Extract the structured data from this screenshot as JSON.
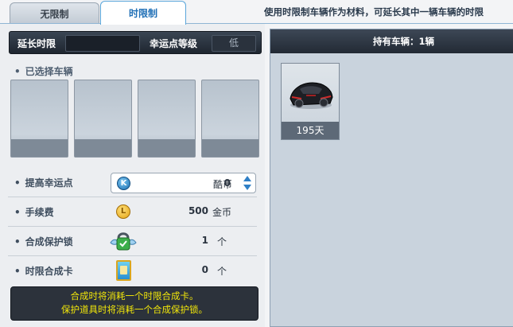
{
  "tabs": [
    {
      "label": "无限制",
      "active": false
    },
    {
      "label": "时限制",
      "active": true
    }
  ],
  "hint_text": "使用时限制车辆作为材料，可延长其中一辆车辆的时限",
  "extend_bar": {
    "extend_label": "延长时限",
    "extend_value": "",
    "luck_level_label": "幸运点等级",
    "luck_level_value": "低"
  },
  "selected_section": {
    "title": "已选择车辆",
    "slot_count": 4
  },
  "rows": {
    "luck_points": {
      "label": "提高幸运点",
      "icon": "k-coin-icon",
      "value": "0",
      "unit": "酷币"
    },
    "fee": {
      "label": "手续费",
      "icon": "gold-coin-icon",
      "value": "500",
      "unit": "金币"
    },
    "protect_lock": {
      "label": "合成保护锁",
      "icon": "protection-lock-icon",
      "value": "1",
      "unit": "个"
    },
    "time_card": {
      "label": "时限合成卡",
      "icon": "time-card-icon",
      "value": "0",
      "unit": "个"
    }
  },
  "notice": {
    "line1": "合成时将消耗一个时限合成卡。",
    "line2": "保护道具时将消耗一个合成保护锁。"
  },
  "owned": {
    "title": "持有车辆：1辆",
    "cars": [
      {
        "days": "195天"
      }
    ]
  },
  "colors": {
    "accent_blue": "#1f6fb6",
    "notice_text": "#f1e60a",
    "dark_bar": "#2c323b"
  }
}
